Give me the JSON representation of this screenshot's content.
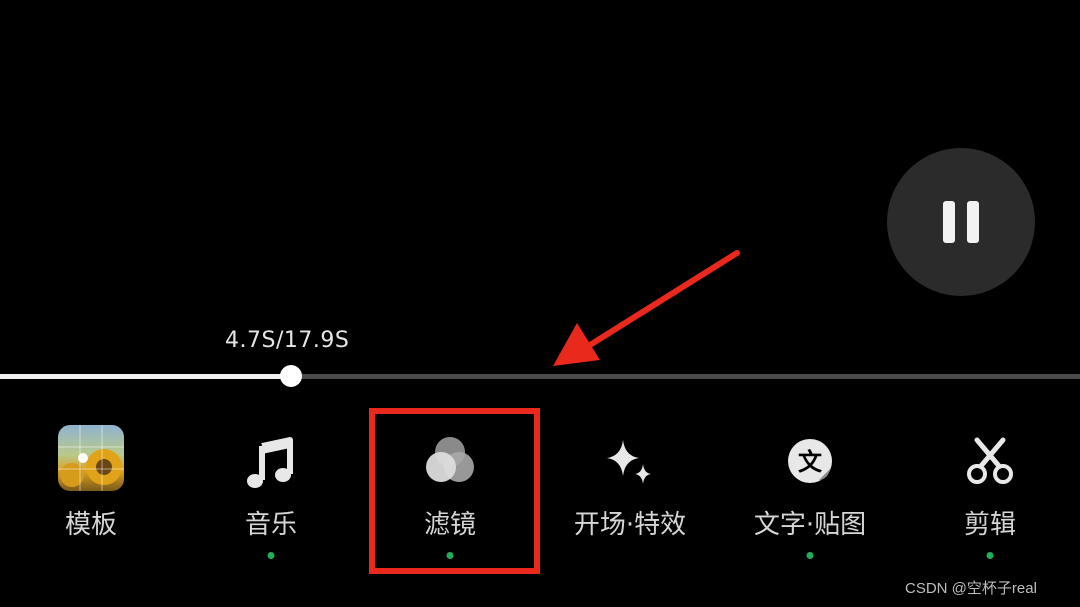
{
  "player": {
    "time_display": "4.7S/17.9S",
    "current_seconds": 4.7,
    "total_seconds": 17.9,
    "progress": 0.269
  },
  "toolbar": {
    "items": [
      {
        "label": "模板",
        "icon": "template-thumbnail",
        "dot": false
      },
      {
        "label": "音乐",
        "icon": "music-note-icon",
        "dot": true
      },
      {
        "label": "滤镜",
        "icon": "filter-circles-icon",
        "dot": true
      },
      {
        "label": "开场·特效",
        "icon": "sparkle-icon",
        "dot": false
      },
      {
        "label": "文字·贴图",
        "icon": "text-sticker-icon",
        "dot": true
      },
      {
        "label": "剪辑",
        "icon": "scissors-icon",
        "dot": true
      }
    ]
  },
  "annotation": {
    "highlight_color": "#e8291c",
    "arrow_color": "#e8291c"
  },
  "watermark": "CSDN @空杯子real"
}
